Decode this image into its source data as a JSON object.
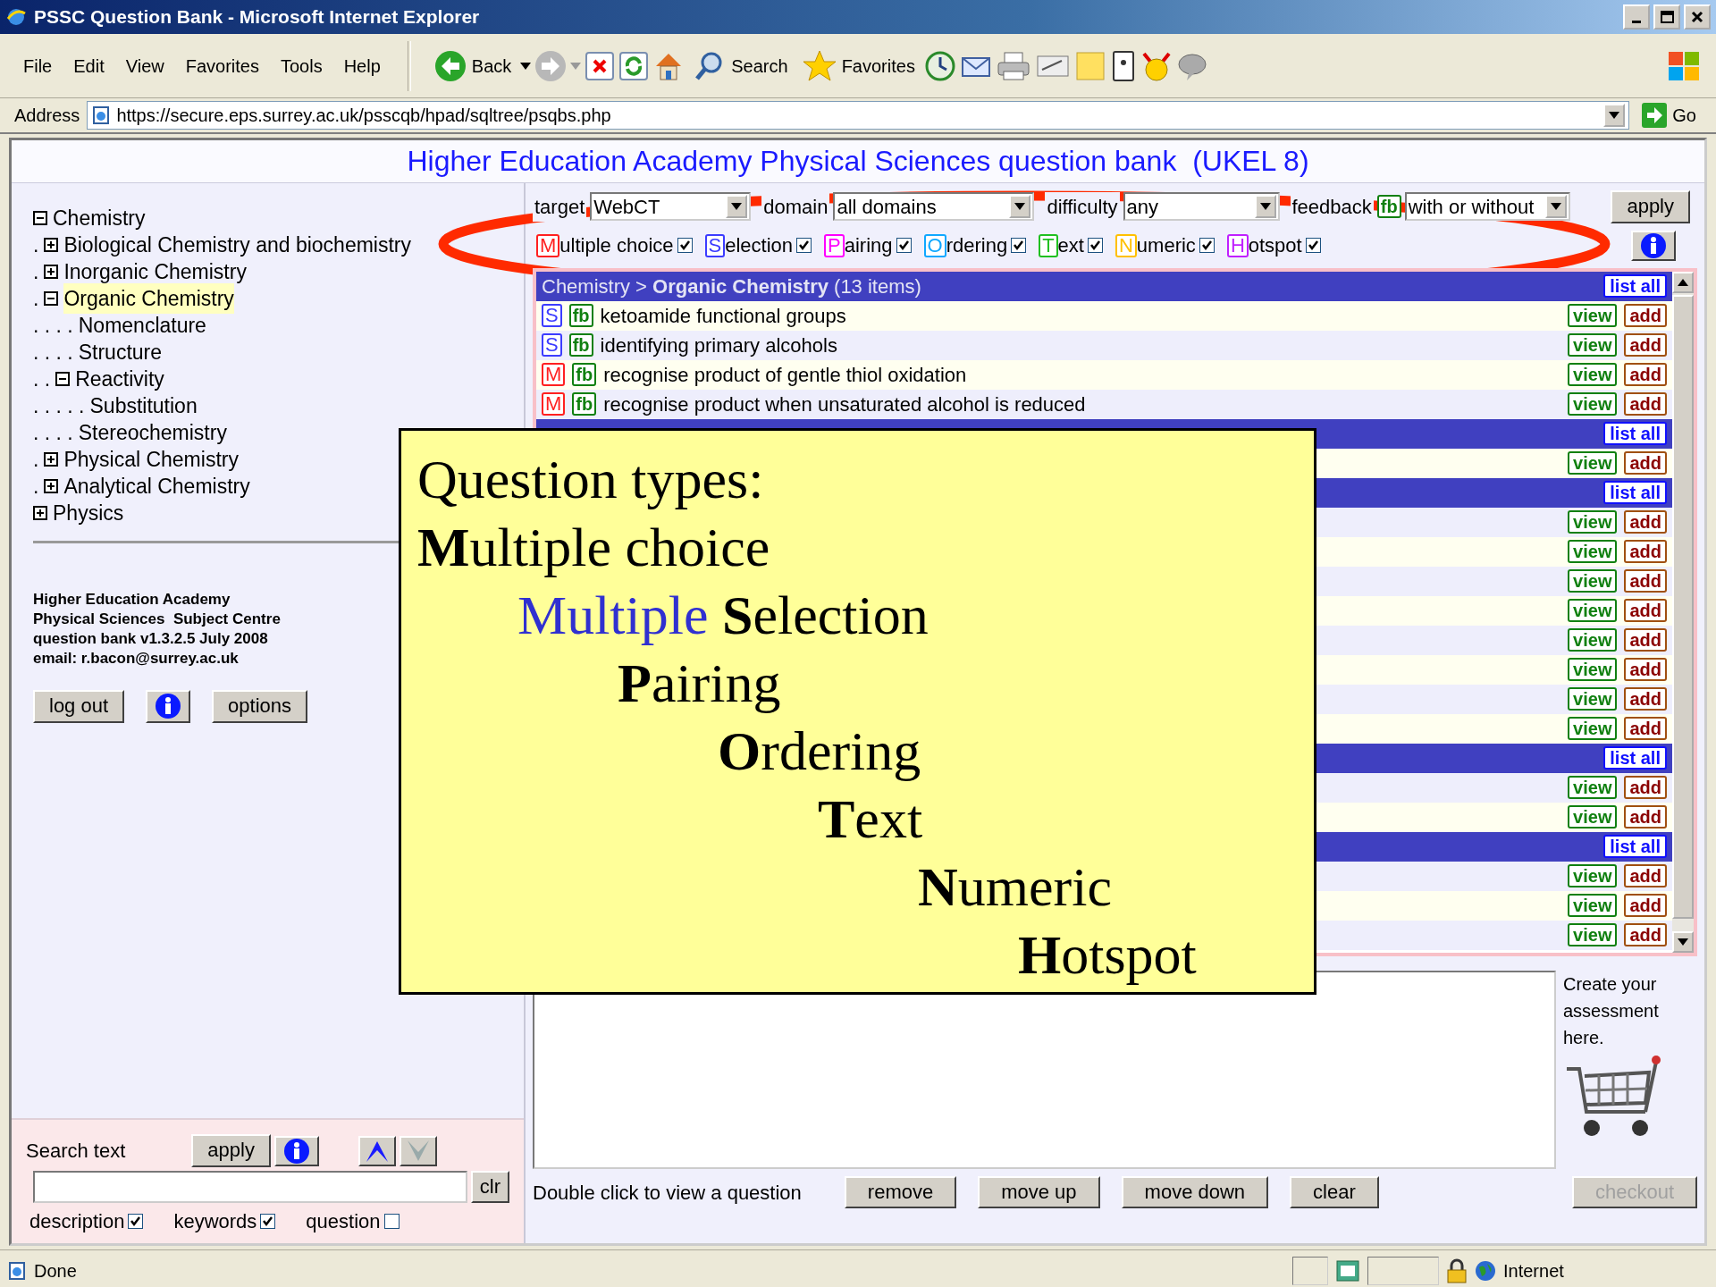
{
  "window": {
    "title": "PSSC Question Bank - Microsoft Internet Explorer"
  },
  "menu": [
    "File",
    "Edit",
    "View",
    "Favorites",
    "Tools",
    "Help"
  ],
  "toolbar": {
    "back": "Back",
    "search": "Search",
    "favorites": "Favorites"
  },
  "address": {
    "label": "Address",
    "url": "https://secure.eps.surrey.ac.uk/psscqb/hpad/sqltree/psqbs.php",
    "go": "Go"
  },
  "page_title": "Higher Education Academy Physical Sciences question bank  (UKEL 8)",
  "tree": [
    {
      "label": "Chemistry",
      "expanded": true,
      "selected": false,
      "children": [
        {
          "dots": ".",
          "label": "Biological Chemistry and biochemistry",
          "expanded": false,
          "selected": false
        },
        {
          "dots": ".",
          "label": "Inorganic Chemistry",
          "expanded": false,
          "selected": false
        },
        {
          "dots": ".",
          "label": "Organic Chemistry",
          "expanded": true,
          "selected": true,
          "children": [
            {
              "dots": ". . . .",
              "label": "Nomenclature",
              "selected": false
            },
            {
              "dots": ". . . .",
              "label": "Structure",
              "selected": false
            },
            {
              "dots": ". .",
              "label": "Reactivity",
              "expanded": true,
              "selected": false,
              "children": [
                {
                  "dots": ". . . . .",
                  "label": "Substitution",
                  "selected": false
                }
              ]
            },
            {
              "dots": ". . . .",
              "label": "Stereochemistry",
              "selected": false
            }
          ]
        },
        {
          "dots": ".",
          "label": "Physical Chemistry",
          "expanded": false,
          "selected": false
        },
        {
          "dots": ".",
          "label": "Analytical Chemistry",
          "expanded": false,
          "selected": false
        }
      ]
    },
    {
      "label": "Physics",
      "expanded": false,
      "selected": false
    }
  ],
  "about": [
    "Higher Education Academy",
    "Physical Sciences  Subject Centre",
    "question bank v1.3.2.5 July 2008",
    "email: r.bacon@surrey.ac.uk"
  ],
  "left_buttons": {
    "logout": "log out",
    "options": "options"
  },
  "search": {
    "label": "Search text",
    "apply": "apply",
    "clear": "clr",
    "options": [
      {
        "label": "description",
        "checked": true
      },
      {
        "label": "keywords",
        "checked": true
      },
      {
        "label": "question",
        "checked": false
      }
    ]
  },
  "filters": {
    "target_label": "target",
    "target": "WebCT",
    "domain_label": "domain",
    "domain": "all domains",
    "difficulty_label": "difficulty",
    "difficulty": "any",
    "feedback_label": "feedback",
    "feedback_badge": "fb",
    "feedback": "with or without",
    "apply": "apply"
  },
  "types": [
    {
      "letter": "M",
      "label": "ultiple choice",
      "color": "#ff2020",
      "checked": true
    },
    {
      "letter": "S",
      "label": "election",
      "color": "#3c3cff",
      "checked": true
    },
    {
      "letter": "P",
      "label": "airing",
      "color": "#ff00ff",
      "checked": true
    },
    {
      "letter": "O",
      "label": "rdering",
      "color": "#10a8ff",
      "checked": true
    },
    {
      "letter": "T",
      "label": "ext",
      "color": "#20c020",
      "checked": true
    },
    {
      "letter": "N",
      "label": "umeric",
      "color": "#ffc000",
      "checked": true
    },
    {
      "letter": "H",
      "label": "otspot",
      "color": "#c020ff",
      "checked": true
    }
  ],
  "list": [
    {
      "kind": "header",
      "title": "Chemistry > **Organic Chemistry** (13 items)",
      "button": "list all"
    },
    {
      "kind": "question",
      "type": "S",
      "color": "#3c3cff",
      "fb": "fb",
      "text": "ketoamide functional groups",
      "view": "view",
      "add": "add"
    },
    {
      "kind": "question",
      "type": "S",
      "color": "#3c3cff",
      "fb": "fb",
      "text": "identifying primary alcohols",
      "view": "view",
      "add": "add"
    },
    {
      "kind": "question",
      "type": "M",
      "color": "#ff2020",
      "fb": "fb",
      "text": "recognise product of gentle thiol oxidation",
      "view": "view",
      "add": "add"
    },
    {
      "kind": "question",
      "type": "M",
      "color": "#ff2020",
      "fb": "fb",
      "text": "recognise product when unsaturated alcohol is reduced",
      "view": "view",
      "add": "add"
    },
    {
      "kind": "header",
      "button": "list all"
    },
    {
      "kind": "question",
      "view": "view",
      "add": "add"
    },
    {
      "kind": "header",
      "button": "list all"
    },
    {
      "kind": "question",
      "view": "view",
      "add": "add"
    },
    {
      "kind": "question",
      "view": "view",
      "add": "add"
    },
    {
      "kind": "question",
      "view": "view",
      "add": "add"
    },
    {
      "kind": "question",
      "view": "view",
      "add": "add"
    },
    {
      "kind": "question",
      "view": "view",
      "add": "add"
    },
    {
      "kind": "question",
      "view": "view",
      "add": "add"
    },
    {
      "kind": "question",
      "view": "view",
      "add": "add"
    },
    {
      "kind": "question",
      "view": "view",
      "add": "add"
    },
    {
      "kind": "header",
      "button": "list all"
    },
    {
      "kind": "question",
      "view": "view",
      "add": "add"
    },
    {
      "kind": "question",
      "view": "view",
      "add": "add"
    },
    {
      "kind": "header",
      "button": "list all"
    },
    {
      "kind": "question",
      "view": "view",
      "add": "add"
    },
    {
      "kind": "question",
      "view": "view",
      "add": "add"
    },
    {
      "kind": "question",
      "view": "view",
      "add": "add"
    }
  ],
  "basket": {
    "note": "Create your assessment here.",
    "checkout": "checkout",
    "checkout_disabled": true
  },
  "actions": {
    "hint": "Double click to view a question",
    "buttons": [
      "remove",
      "move up",
      "move down",
      "clear"
    ]
  },
  "callout": {
    "lines": [
      {
        "text": "Question types:"
      },
      {
        "text": "**M**ultiple choice"
      },
      {
        "prefix": "Multiple",
        "text": "**S**election"
      },
      {
        "text": "**P**airing"
      },
      {
        "text": "**O**rdering"
      },
      {
        "text": "**T**ext"
      },
      {
        "text": "**N**umeric"
      },
      {
        "text": "**H**otspot"
      }
    ]
  },
  "status_bar": {
    "text": "Done",
    "zone": "Internet"
  }
}
